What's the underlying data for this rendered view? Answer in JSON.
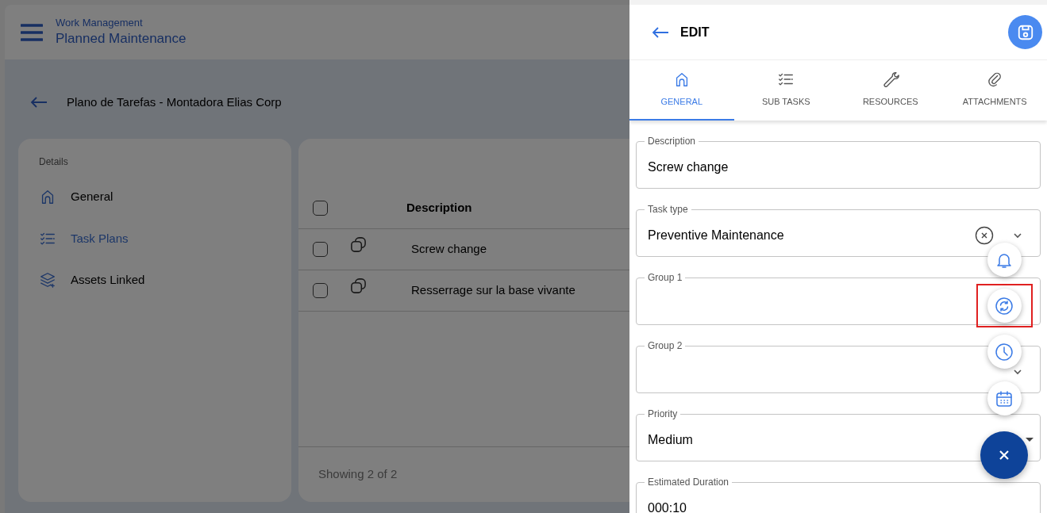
{
  "app_header": {
    "section": "Work Management",
    "title": "Planned Maintenance"
  },
  "page_title": "Plano de Tarefas - Montadora Elias Corp",
  "sidebar": {
    "heading": "Details",
    "items": [
      {
        "label": "General",
        "selected": false
      },
      {
        "label": "Task Plans",
        "selected": true
      },
      {
        "label": "Assets Linked",
        "selected": false
      }
    ]
  },
  "table": {
    "header_checked": false,
    "columns": [
      "Description"
    ],
    "rows": [
      {
        "checked": false,
        "description": "Screw change"
      },
      {
        "checked": false,
        "description": "Resserrage sur la base vivante"
      }
    ],
    "footer": "Showing 2 of 2"
  },
  "edit_panel": {
    "title": "EDIT",
    "tabs": [
      {
        "label": "GENERAL",
        "selected": true
      },
      {
        "label": "SUB TASKS",
        "selected": false
      },
      {
        "label": "RESOURCES",
        "selected": false
      },
      {
        "label": "ATTACHMENTS",
        "selected": false
      }
    ],
    "fields": [
      {
        "label": "Description",
        "value": "Screw change",
        "kind": "text"
      },
      {
        "label": "Task type",
        "value": "Preventive Maintenance",
        "kind": "clearable"
      },
      {
        "label": "Group 1",
        "kind": "text"
      },
      {
        "label": "Group 2",
        "kind": "combo"
      },
      {
        "label": "Priority",
        "value": "Medium",
        "kind": "select"
      },
      {
        "label": "Estimated Duration",
        "value": "000:10",
        "kind": "text"
      }
    ]
  },
  "speed_dial": {
    "expanded": true,
    "actions": [
      {
        "highlighted": false
      },
      {
        "highlighted": true
      },
      {
        "highlighted": false
      },
      {
        "highlighted": false
      }
    ]
  }
}
